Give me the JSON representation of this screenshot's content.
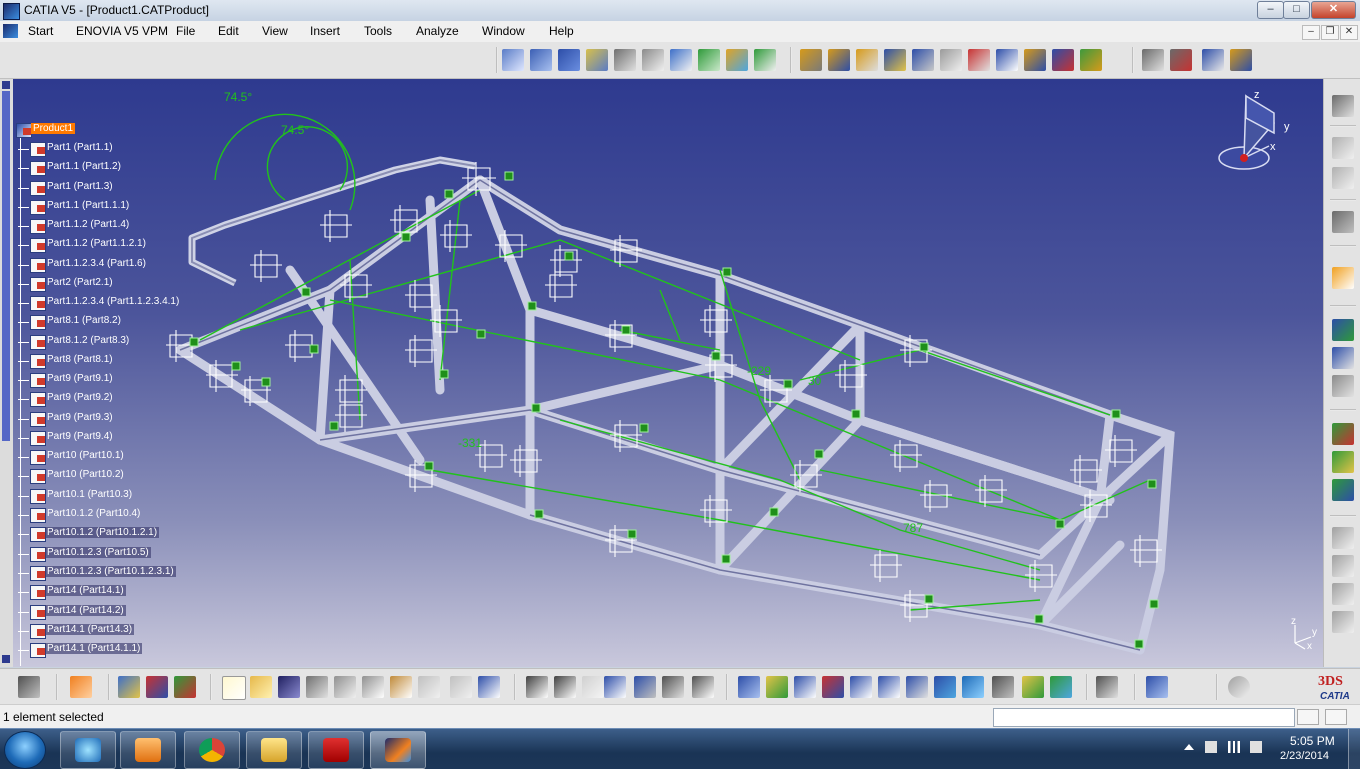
{
  "window": {
    "title": "CATIA V5 - [Product1.CATProduct]",
    "controls": {
      "minimize": "–",
      "maximize": "□",
      "close": "✕"
    },
    "doc_controls": {
      "minimize": "–",
      "restore": "❐",
      "close": "✕"
    }
  },
  "menu": {
    "items": [
      "Start",
      "ENOVIA V5 VPM",
      "File",
      "Edit",
      "View",
      "Insert",
      "Tools",
      "Analyze",
      "Window",
      "Help"
    ]
  },
  "tree": {
    "root": "Product1",
    "items": [
      "Part1 (Part1.1)",
      "Part1.1 (Part1.2)",
      "Part1 (Part1.3)",
      "Part1.1 (Part1.1.1)",
      "Part1.1.2 (Part1.4)",
      "Part1.1.2 (Part1.1.2.1)",
      "Part1.1.2.3.4 (Part1.6)",
      "Part2 (Part2.1)",
      "Part1.1.2.3.4 (Part1.1.2.3.4.1)",
      "Part8.1 (Part8.2)",
      "Part8.1.2 (Part8.3)",
      "Part8 (Part8.1)",
      "Part9 (Part9.1)",
      "Part9 (Part9.2)",
      "Part9 (Part9.3)",
      "Part9 (Part9.4)",
      "Part10 (Part10.1)",
      "Part10 (Part10.2)",
      "Part10.1 (Part10.3)",
      "Part10.1.2 (Part10.4)",
      "Part10.1.2 (Part10.1.2.1)",
      "Part10.1.2.3 (Part10.5)",
      "Part10.1.2.3 (Part10.1.2.3.1)",
      "Part14 (Part14.1)",
      "Part14 (Part14.2)",
      "Part14.1 (Part14.3)",
      "Part14.1 (Part14.1.1)"
    ]
  },
  "viewport": {
    "dimensions": [
      "74.5°",
      "74.5°",
      "-229",
      "787",
      "-331",
      "30"
    ],
    "compass_axes": [
      "z",
      "y",
      "x"
    ],
    "corner_axes": [
      "z",
      "y",
      "x"
    ],
    "colors": {
      "background_top": "#2e3a8f",
      "background_bottom": "#c9c8dc",
      "frame": "#c8cbe0",
      "constraint": "#21c21b",
      "selection": "#ff7a00"
    }
  },
  "statusbar": {
    "text": "1 element selected"
  },
  "taskbar": {
    "time": "5:05 PM",
    "date": "2/23/2014",
    "apps": [
      "ie-icon",
      "media-icon",
      "chrome-icon",
      "explorer-icon",
      "acrobat-icon",
      "catia-icon"
    ]
  }
}
